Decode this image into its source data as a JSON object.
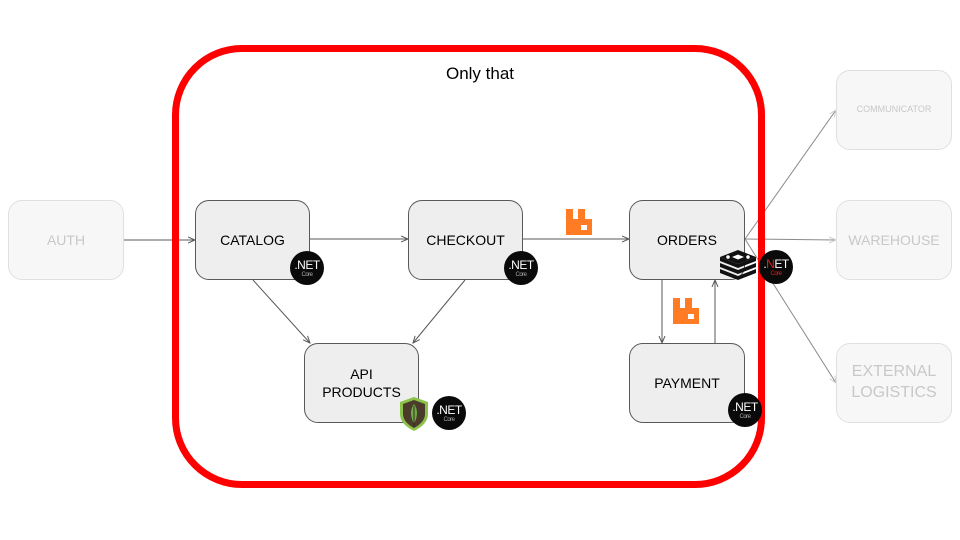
{
  "diagram": {
    "frame_title": "Only that",
    "frame_color": "#ff0000",
    "nodes": {
      "auth": {
        "label": "AUTH",
        "status": "out-of-scope"
      },
      "catalog": {
        "label": "CATALOG",
        "status": "in-scope",
        "tech": [
          "dotnet-core"
        ]
      },
      "checkout": {
        "label": "CHECKOUT",
        "status": "in-scope",
        "tech": [
          "dotnet-core"
        ]
      },
      "orders": {
        "label": "ORDERS",
        "status": "in-scope",
        "tech": [
          "redis",
          "dotnet-core"
        ]
      },
      "api_products": {
        "label_line1": "API",
        "label_line2": "PRODUCTS",
        "status": "in-scope",
        "tech": [
          "mongodb",
          "dotnet-core"
        ]
      },
      "payment": {
        "label": "PAYMENT",
        "status": "in-scope",
        "tech": [
          "dotnet-core"
        ]
      },
      "communicator": {
        "label": "COMMUNICATOR",
        "status": "out-of-scope"
      },
      "warehouse": {
        "label": "WAREHOUSE",
        "status": "out-of-scope"
      },
      "external_logistics": {
        "label_line1": "EXTERNAL",
        "label_line2": "LOGISTICS",
        "status": "out-of-scope"
      }
    },
    "badge": {
      "main": ".NET",
      "sub": "Core",
      "n_red_prefix": ".",
      "n_red_letter": "N",
      "n_red_rest": "ET"
    },
    "edges": [
      {
        "from": "AUTH",
        "to": "CATALOG"
      },
      {
        "from": "CATALOG",
        "to": "CHECKOUT"
      },
      {
        "from": "CATALOG",
        "to": "API PRODUCTS"
      },
      {
        "from": "CHECKOUT",
        "to": "API PRODUCTS"
      },
      {
        "from": "CHECKOUT",
        "to": "ORDERS",
        "via": "rabbitmq"
      },
      {
        "from": "ORDERS",
        "to": "PAYMENT",
        "via": "rabbitmq"
      },
      {
        "from": "PAYMENT",
        "to": "ORDERS"
      },
      {
        "from": "ORDERS",
        "to": "COMMUNICATOR"
      },
      {
        "from": "ORDERS",
        "to": "WAREHOUSE"
      },
      {
        "from": "ORDERS",
        "to": "EXTERNAL LOGISTICS"
      }
    ],
    "colors": {
      "rabbitmq": "#ff7b24",
      "mongodb_leaf": "#589636",
      "frame": "#ff0000"
    }
  }
}
